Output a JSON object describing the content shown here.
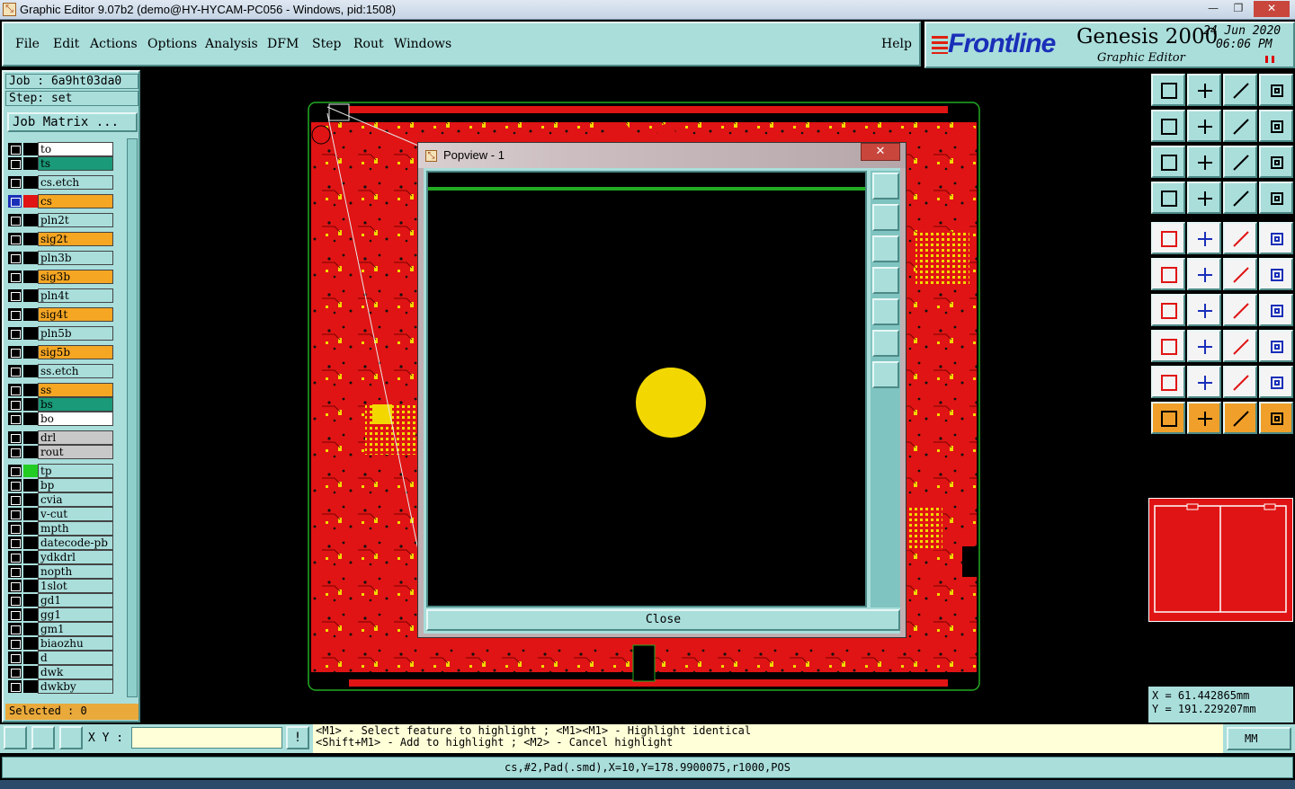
{
  "window": {
    "title": "Graphic Editor 9.07b2 (demo@HY-HYCAM-PC056 - Windows, pid:1508)",
    "app_icon_glyph": "⤡",
    "controls": {
      "minimize": "—",
      "restore": "❐",
      "close": "✕"
    }
  },
  "menu": {
    "items": [
      "File",
      "Edit",
      "Actions",
      "Options",
      "Analysis",
      "DFM",
      "Step",
      "Rout",
      "Windows"
    ],
    "help": "Help"
  },
  "brand": {
    "logo": "Frontline",
    "product": "Genesis 2000",
    "subtitle": "Graphic Editor",
    "date": "24 Jun 2020",
    "time": "06:06 PM"
  },
  "job": {
    "job_label": "Job : 6a9ht03da0",
    "step_label": "Step: set",
    "job_matrix": "Job Matrix ..."
  },
  "layers": [
    {
      "name": "to",
      "color": "#ffffff",
      "swatch": ""
    },
    {
      "name": "ts",
      "color": "#1a9a78",
      "swatch": ""
    },
    {
      "name": "cs.etch",
      "color": "#a9dedb",
      "swatch": ""
    },
    {
      "name": "cs",
      "color": "#f5a623",
      "swatch": "#e01414",
      "active": true
    },
    {
      "name": "pln2t",
      "color": "#a9dedb",
      "swatch": ""
    },
    {
      "name": "sig2t",
      "color": "#f5a623",
      "swatch": ""
    },
    {
      "name": "pln3b",
      "color": "#a9dedb",
      "swatch": ""
    },
    {
      "name": "sig3b",
      "color": "#f5a623",
      "swatch": ""
    },
    {
      "name": "pln4t",
      "color": "#a9dedb",
      "swatch": ""
    },
    {
      "name": "sig4t",
      "color": "#f5a623",
      "swatch": ""
    },
    {
      "name": "pln5b",
      "color": "#a9dedb",
      "swatch": ""
    },
    {
      "name": "sig5b",
      "color": "#f5a623",
      "swatch": ""
    },
    {
      "name": "ss.etch",
      "color": "#a9dedb",
      "swatch": ""
    },
    {
      "name": "ss",
      "color": "#f5a623",
      "swatch": ""
    },
    {
      "name": "bs",
      "color": "#1a9a78",
      "swatch": ""
    },
    {
      "name": "bo",
      "color": "#ffffff",
      "swatch": ""
    },
    {
      "name": "drl",
      "color": "#c8c8c8",
      "swatch": ""
    },
    {
      "name": "rout",
      "color": "#c8c8c8",
      "swatch": ""
    },
    {
      "name": "tp",
      "color": "#a9dedb",
      "swatch": "#22cc22"
    },
    {
      "name": "bp",
      "color": "#a9dedb",
      "swatch": ""
    },
    {
      "name": "cvia",
      "color": "#a9dedb",
      "swatch": ""
    },
    {
      "name": "v-cut",
      "color": "#a9dedb",
      "swatch": ""
    },
    {
      "name": "mpth",
      "color": "#a9dedb",
      "swatch": ""
    },
    {
      "name": "datecode-pb",
      "color": "#a9dedb",
      "swatch": ""
    },
    {
      "name": "ydkdrl",
      "color": "#a9dedb",
      "swatch": ""
    },
    {
      "name": "nopth",
      "color": "#a9dedb",
      "swatch": ""
    },
    {
      "name": "1slot",
      "color": "#a9dedb",
      "swatch": ""
    },
    {
      "name": "gd1",
      "color": "#a9dedb",
      "swatch": ""
    },
    {
      "name": "gg1",
      "color": "#a9dedb",
      "swatch": ""
    },
    {
      "name": "gm1",
      "color": "#a9dedb",
      "swatch": ""
    },
    {
      "name": "biaozhu",
      "color": "#a9dedb",
      "swatch": ""
    },
    {
      "name": "d",
      "color": "#a9dedb",
      "swatch": ""
    },
    {
      "name": "dwk",
      "color": "#a9dedb",
      "swatch": ""
    },
    {
      "name": "dwkby",
      "color": "#a9dedb",
      "swatch": ""
    }
  ],
  "selected": "Selected : 0",
  "popview": {
    "title": "Popview - 1",
    "close_x": "✕",
    "close_button": "Close"
  },
  "coords": {
    "x": "X  =  61.442865mm",
    "y": "Y  = 191.229207mm"
  },
  "bottom": {
    "xy_label": "X Y :",
    "xy_value": "",
    "hint_line1": "<M1> - Select feature to highlight ; <M1><M1> - Highlight identical",
    "hint_line2": "<Shift+M1> - Add to highlight ; <M2> - Cancel highlight",
    "units": "MM",
    "alert": "!"
  },
  "status": "cs,#2,Pad(.smd),X=10,Y=178.9900075,r1000,POS",
  "toolbar_icons": [
    "zoom-home-icon",
    "zoom-in-icon",
    "zoom-home-alt-icon",
    "zoom-window-icon",
    "pan-left-icon",
    "pan-right-icon",
    "mirror-icon",
    "step-icon",
    "fit-icon",
    "center-icon",
    "scale-icon",
    "help-icon",
    "settings-icon",
    "grid-icon",
    "snap-icon",
    "snap-alt-icon",
    "select-icon",
    "add-icon",
    "measure-icon",
    "pad-icon",
    "net-icon",
    "delete-icon",
    "move-icon",
    "copy-icon",
    "line-icon",
    "arc-icon",
    "rotate-icon",
    "text-icon",
    "connect-icon",
    "cut-icon",
    "resize-icon",
    "shape-icon",
    "drc-icon",
    "drc-up-icon",
    "drc-arrow-icon",
    "drc-check-icon",
    "pointer-icon",
    "pointer-box-icon",
    "pointer-round-icon",
    "route-icon"
  ],
  "colors": {
    "panel": "#a9dedb",
    "board": "#e01414",
    "pads": "#f2d800",
    "outline": "#22aa22"
  }
}
